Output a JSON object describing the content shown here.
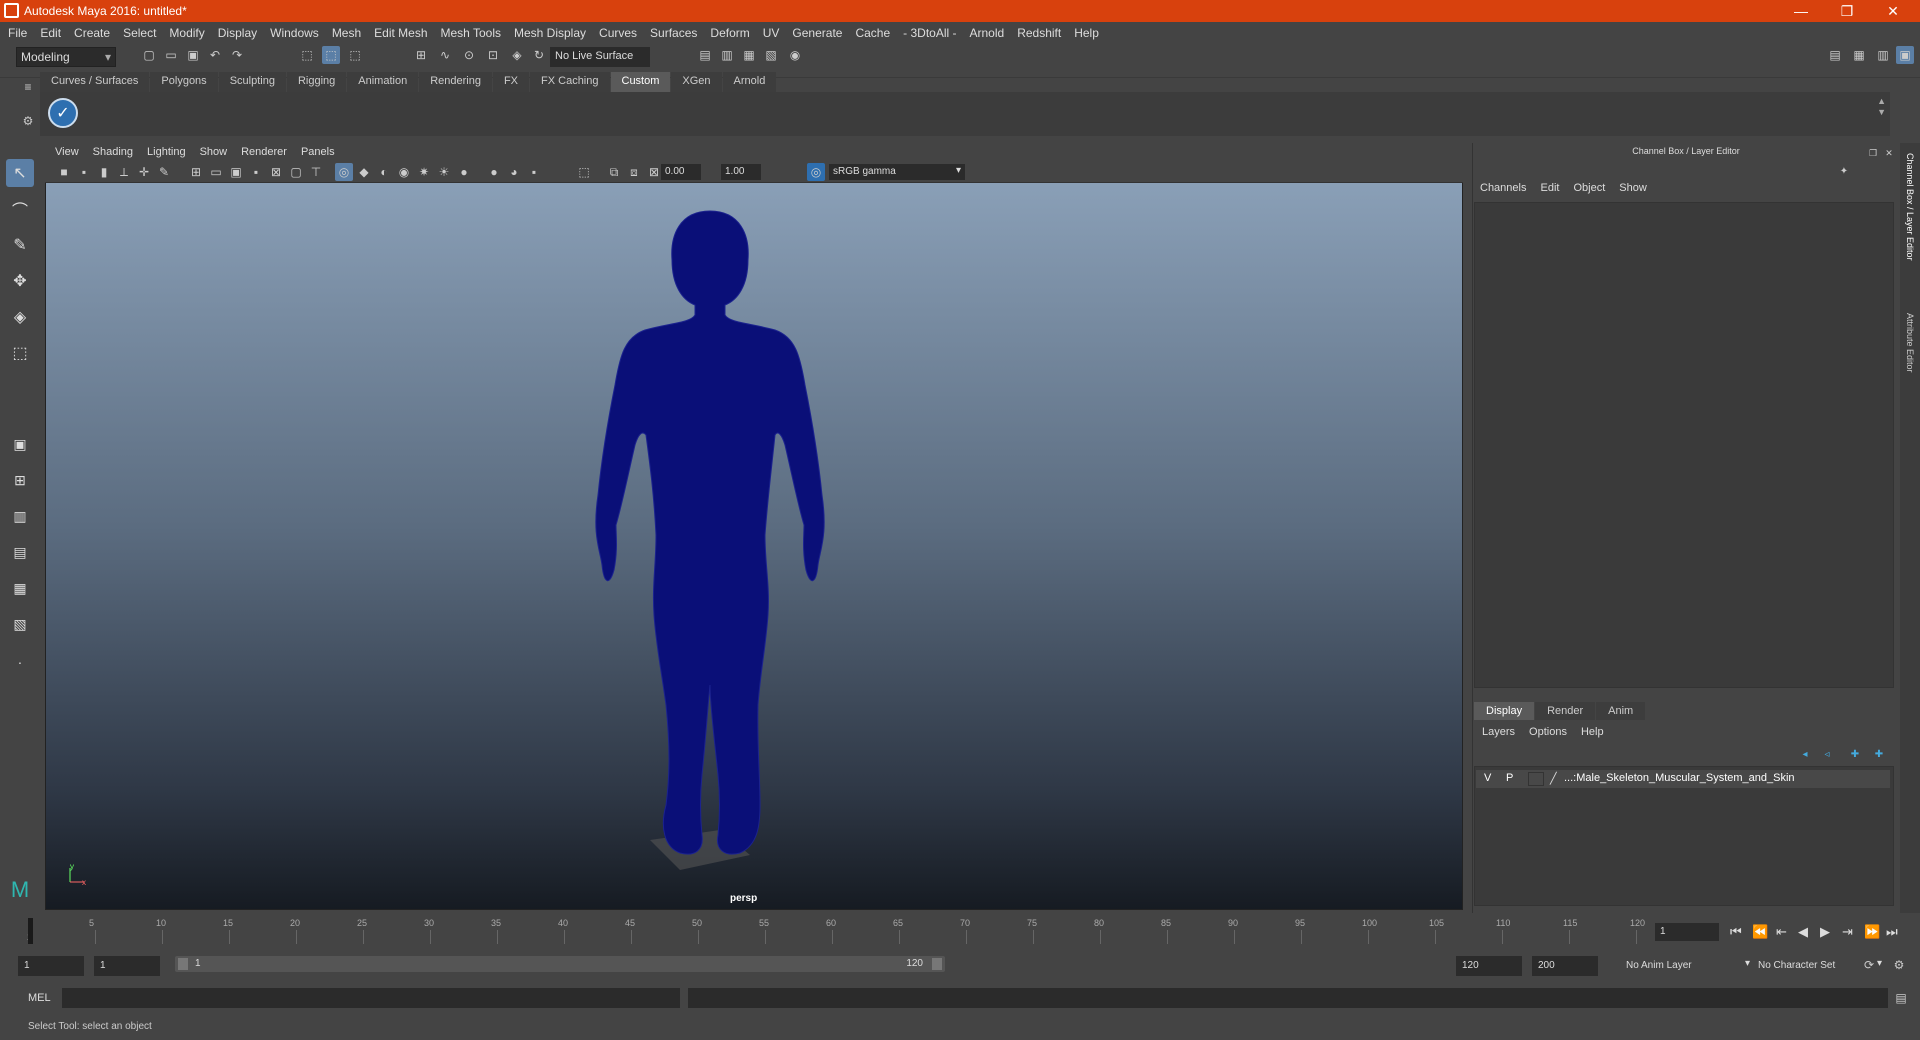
{
  "window": {
    "title": "Autodesk Maya 2016: untitled*",
    "controls": [
      "—",
      "❐",
      "✕"
    ]
  },
  "menu": [
    "File",
    "Edit",
    "Create",
    "Select",
    "Modify",
    "Display",
    "Windows",
    "Mesh",
    "Edit Mesh",
    "Mesh Tools",
    "Mesh Display",
    "Curves",
    "Surfaces",
    "Deform",
    "UV",
    "Generate",
    "Cache",
    "- 3DtoAll -",
    "Arnold",
    "Redshift",
    "Help"
  ],
  "statusline": {
    "mode": "Modeling",
    "live_surface": "No Live Surface"
  },
  "shelf_tabs": [
    "Curves / Surfaces",
    "Polygons",
    "Sculpting",
    "Rigging",
    "Animation",
    "Rendering",
    "FX",
    "FX Caching",
    "Custom",
    "XGen",
    "Arnold"
  ],
  "shelf_active": "Custom",
  "viewport": {
    "menu": [
      "View",
      "Shading",
      "Lighting",
      "Show",
      "Renderer",
      "Panels"
    ],
    "exposure": "0.00",
    "gamma": "1.00",
    "color_space": "sRGB gamma",
    "camera": "persp",
    "axis_y": "y",
    "axis_x": "x"
  },
  "channel_box": {
    "title": "Channel Box / Layer Editor",
    "menu": [
      "Channels",
      "Edit",
      "Object",
      "Show"
    ]
  },
  "layer_editor": {
    "tabs": [
      "Display",
      "Render",
      "Anim"
    ],
    "active_tab": "Display",
    "menu": [
      "Layers",
      "Options",
      "Help"
    ],
    "layers": [
      {
        "v": "V",
        "p": "P",
        "name": "...:Male_Skeleton_Muscular_System_and_Skin"
      }
    ]
  },
  "side_tabs": [
    "Channel Box / Layer Editor",
    "Attribute Editor"
  ],
  "timeline": {
    "ticks": [
      "5",
      "10",
      "15",
      "20",
      "25",
      "30",
      "35",
      "40",
      "45",
      "50",
      "55",
      "60",
      "65",
      "70",
      "75",
      "80",
      "85",
      "90",
      "95",
      "100",
      "105",
      "110",
      "115",
      "120"
    ],
    "start_marker": "1",
    "current_frame": "1"
  },
  "range": {
    "start": "1",
    "playback_start": "1",
    "slider_start": "1",
    "slider_end": "120",
    "playback_end": "120",
    "end": "200",
    "anim_layer": "No Anim Layer",
    "character_set": "No Character Set"
  },
  "cmdline": {
    "label": "MEL"
  },
  "helpline": "Select Tool: select an object",
  "colors": {
    "titlebar": "#d8410d",
    "mesh": "#0a0f78",
    "active_tab": "#5a5a5a"
  }
}
